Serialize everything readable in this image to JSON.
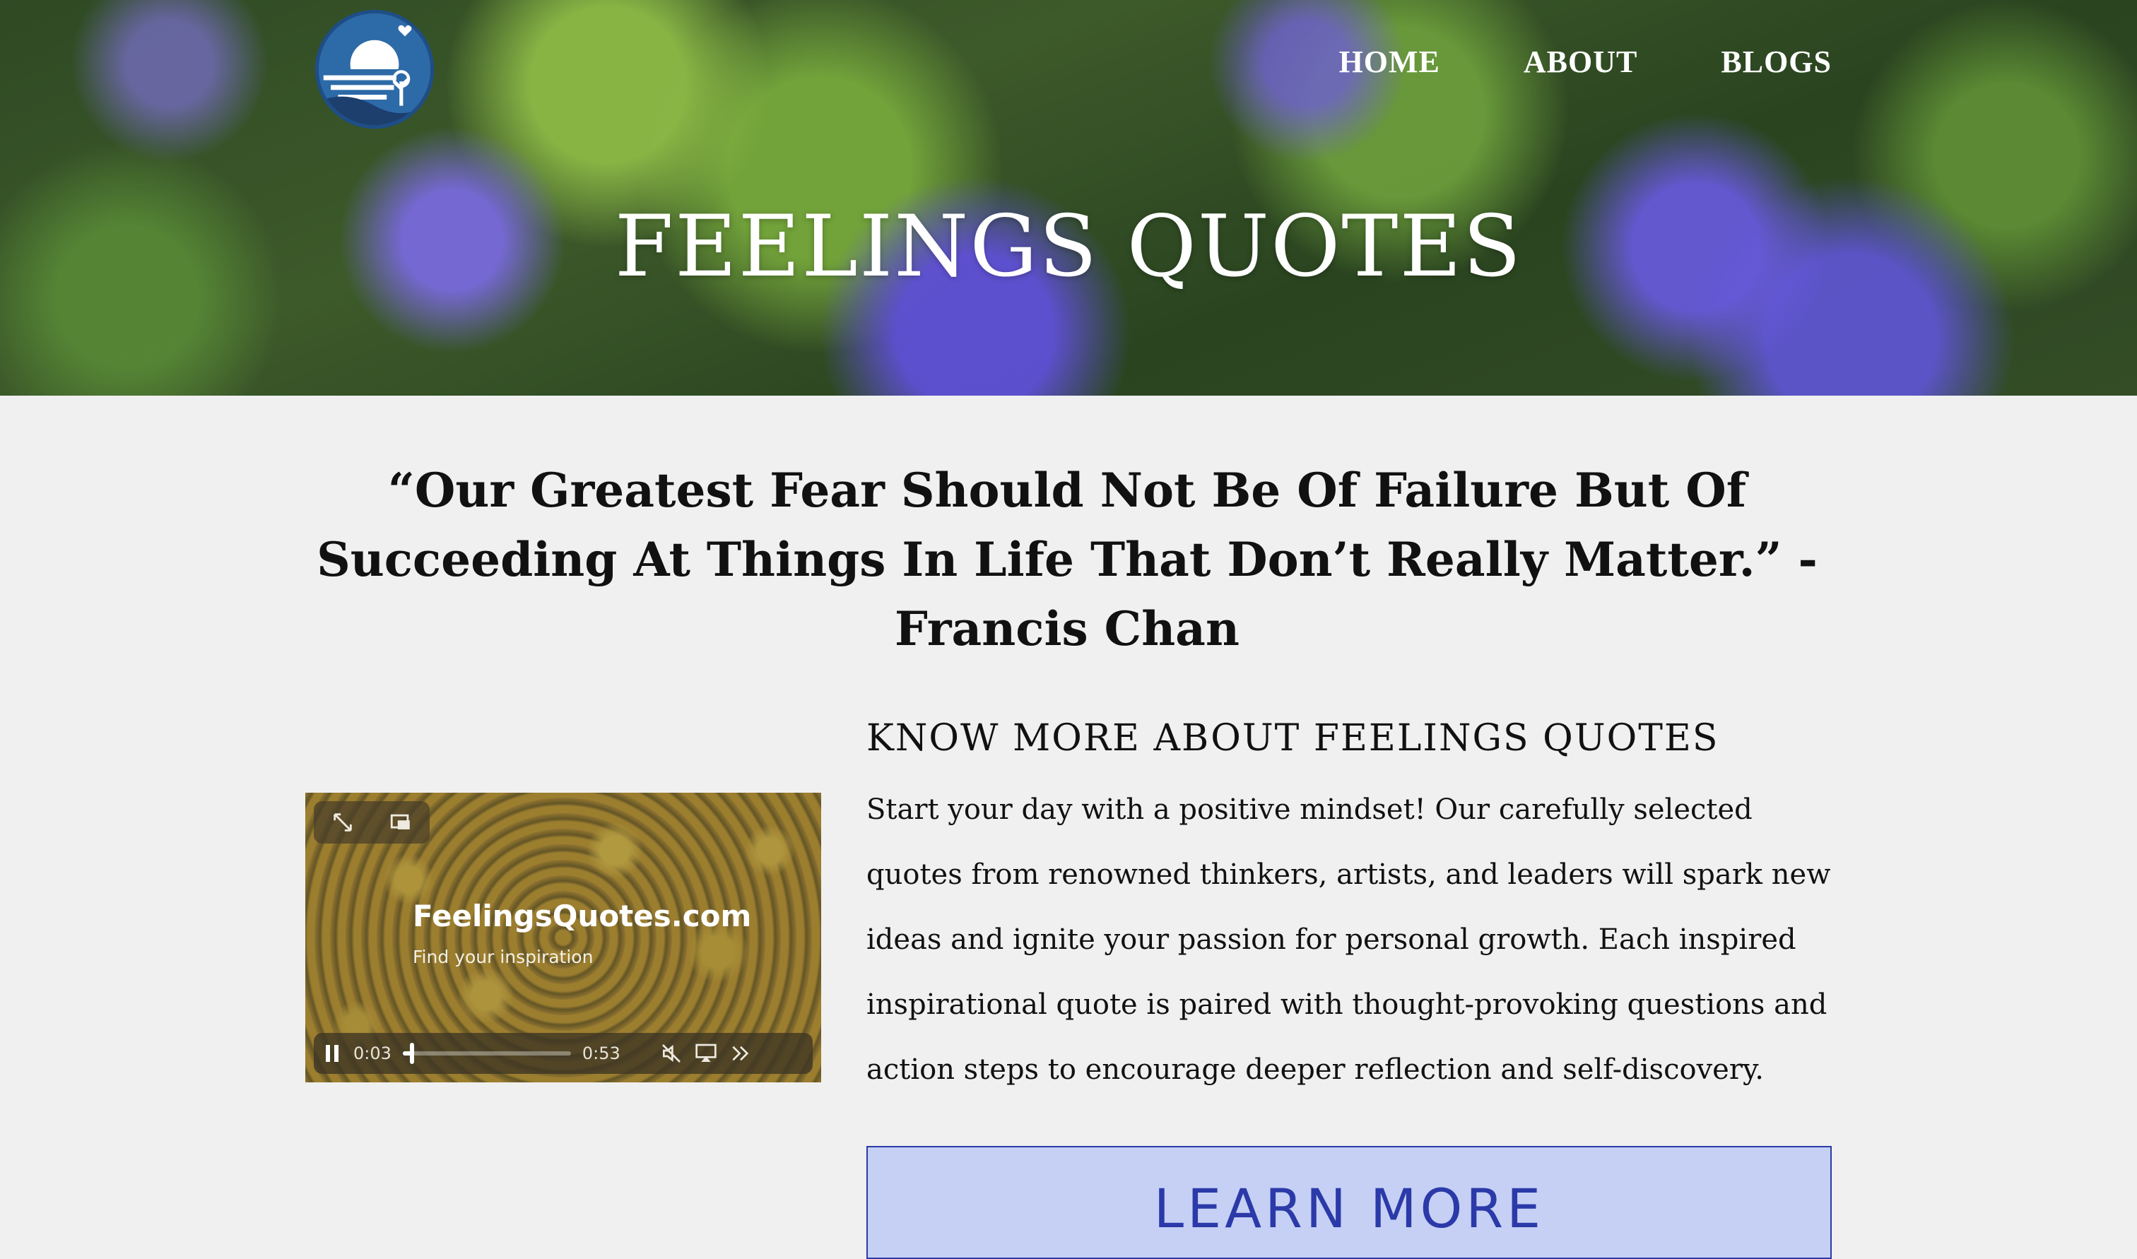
{
  "nav": {
    "home": "HOME",
    "about": "ABOUT",
    "blogs": "BLOGS"
  },
  "hero": {
    "title": "FEELINGS QUOTES"
  },
  "quote": {
    "text": "“Our Greatest Fear Should Not Be Of Failure But Of Succeeding At Things In Life That Don’t Really Matter.” -Francis Chan"
  },
  "video": {
    "brand": "FeelingsQuotes.com",
    "tagline": "Find your inspiration",
    "current_time": "0:03",
    "duration": "0:53",
    "progress_fraction": 0.057
  },
  "about": {
    "heading": "KNOW MORE ABOUT FEELINGS QUOTES",
    "body": "Start your day with a positive mindset! Our carefully selected quotes from renowned thinkers, artists, and leaders will spark new ideas and ignite your passion for personal growth. Each inspired inspirational quote is paired with thought-provoking questions and action steps to encourage deeper reflection and self-discovery.",
    "button_label": "LEARN MORE"
  },
  "colors": {
    "page_bg": "#f0f0f0",
    "button_bg": "#c6d0f5",
    "button_text": "#2b3aa8",
    "logo_blue": "#1f4e86"
  }
}
